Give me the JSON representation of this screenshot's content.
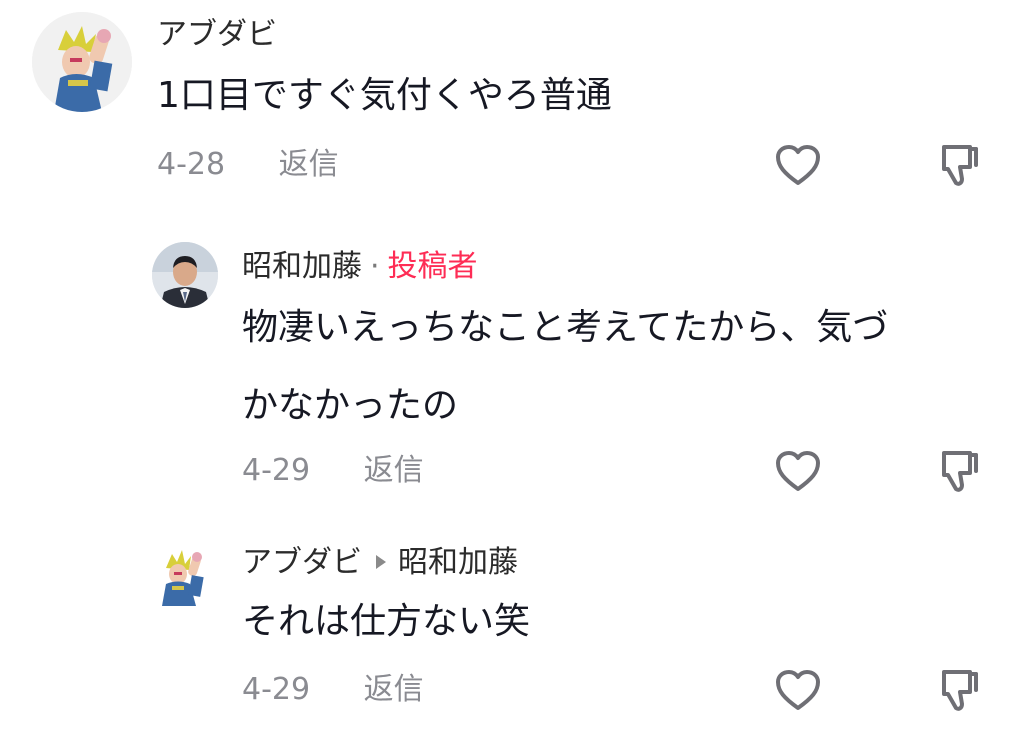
{
  "comments": [
    {
      "username": "アブダビ",
      "text": "1口目ですぐ気付くやろ普通",
      "date": "4-28",
      "reply_label": "返信",
      "avatar_icon": "anime-character-avatar",
      "like_icon": "heart-outline-icon",
      "dislike_icon": "thumbs-down-icon"
    },
    {
      "username": "昭和加藤",
      "separator": "·",
      "author_badge": "投稿者",
      "text_line1": "物凄いえっちなこと考えてたから、気づ",
      "text_line2": "かなかったの",
      "date": "4-29",
      "reply_label": "返信",
      "avatar_icon": "man-in-suit-avatar",
      "like_icon": "heart-outline-icon",
      "dislike_icon": "thumbs-down-icon"
    },
    {
      "username": "アブダビ",
      "reply_to": "昭和加藤",
      "text": "それは仕方ない笑",
      "date": "4-29",
      "reply_label": "返信",
      "avatar_icon": "anime-character-avatar",
      "like_icon": "heart-outline-icon",
      "dislike_icon": "thumbs-down-icon"
    }
  ],
  "colors": {
    "text_primary": "#161823",
    "text_meta": "#8a8b91",
    "author_badge": "#fe2c55",
    "icon": "#6f6f75"
  }
}
